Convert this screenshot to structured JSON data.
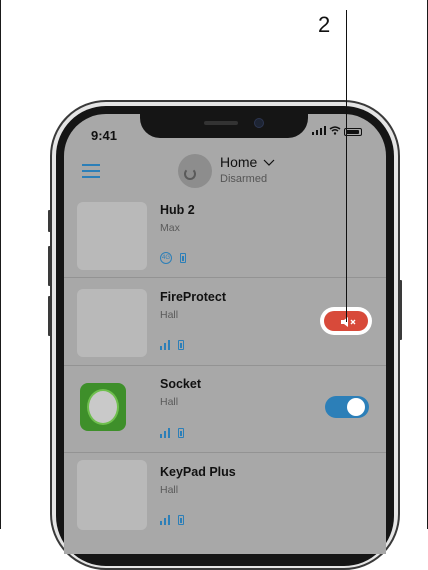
{
  "callout": {
    "number": "2"
  },
  "status_bar": {
    "time": "9:41"
  },
  "header": {
    "hub_title": "Home",
    "hub_state": "Disarmed"
  },
  "devices": [
    {
      "name": "Hub 2",
      "room": "Max",
      "icons": [
        "4g-icon",
        "battery-icon"
      ]
    },
    {
      "name": "FireProtect",
      "room": "Hall",
      "icons": [
        "signal-icon",
        "battery-icon"
      ],
      "action": "mute-alarm"
    },
    {
      "name": "Socket",
      "room": "Hall",
      "icons": [
        "signal-icon",
        "battery-icon"
      ],
      "toggle_on": true
    },
    {
      "name": "KeyPad Plus",
      "room": "Hall",
      "icons": [
        "signal-icon",
        "battery-icon"
      ]
    }
  ],
  "colors": {
    "accent": "#2c7fb8",
    "alarm": "#d84a3a",
    "socket_green": "#3e8f2a"
  }
}
